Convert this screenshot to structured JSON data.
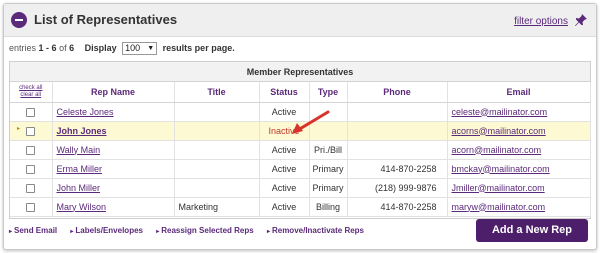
{
  "header": {
    "title": "List of Representatives",
    "filter_label": "filter options"
  },
  "paging": {
    "entries_label": "entries",
    "range": "1 - 6",
    "of_label": "of",
    "total": "6",
    "display_label": "Display",
    "per_page_value": "100",
    "results_label": "results per page."
  },
  "table": {
    "caption": "Member Representatives",
    "check_all": "check all",
    "clear_all": "clear all",
    "columns": [
      "Rep Name",
      "Title",
      "Status",
      "Type",
      "Phone",
      "Email"
    ],
    "rows": [
      {
        "name": "Celeste Jones",
        "title": "",
        "status": "Active",
        "type": "",
        "phone": "",
        "email": "celeste@mailinator.com"
      },
      {
        "name": "John Jones",
        "title": "",
        "status": "Inactive",
        "type": "",
        "phone": "",
        "email": "acorns@mailinator.com"
      },
      {
        "name": "Wally Main",
        "title": "",
        "status": "Active",
        "type": "Pri./Bill",
        "phone": "",
        "email": "acorn@mailinator.com"
      },
      {
        "name": "Erma Miller",
        "title": "",
        "status": "Active",
        "type": "Primary",
        "phone": "414-870-2258",
        "email": "bmckay@mailinator.com"
      },
      {
        "name": "John Miller",
        "title": "",
        "status": "Active",
        "type": "Primary",
        "phone": "(218) 999-9876",
        "email": "Jmiller@mailinator.com"
      },
      {
        "name": "Mary Wilson",
        "title": "Marketing",
        "status": "Active",
        "type": "Billing",
        "phone": "414-870-2258",
        "email": "maryw@mailinator.com"
      }
    ]
  },
  "actions": {
    "send_email": "Send Email",
    "labels": "Labels/Envelopes",
    "reassign": "Reassign Selected Reps",
    "remove": "Remove/Inactivate Reps",
    "add_button": "Add a New Rep"
  },
  "colors": {
    "accent": "#5b2a7a",
    "button": "#4d1f6b",
    "highlight_row": "#fdf9d3",
    "inactive": "#c0392b",
    "arrow": "#d9342b"
  }
}
